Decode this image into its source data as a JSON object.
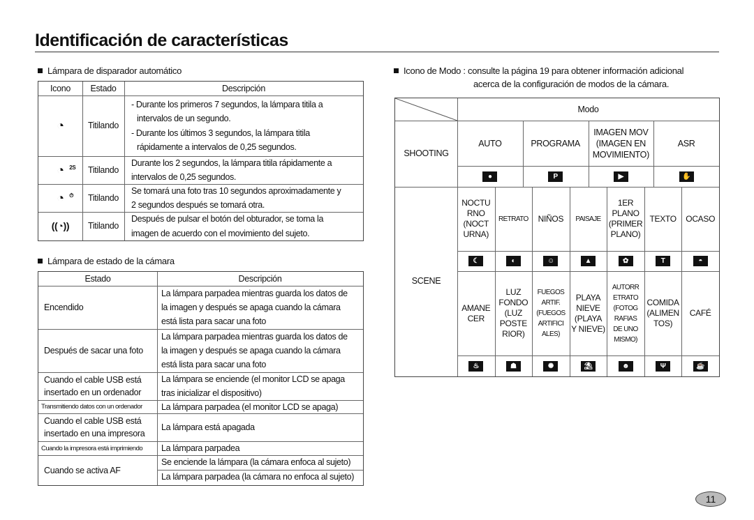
{
  "page": {
    "title": "Identificación de características",
    "page_number": "11"
  },
  "self_timer": {
    "heading": "Lámpara de disparador automático",
    "columns": [
      "Icono",
      "Estado",
      "Descripción"
    ],
    "rows": [
      {
        "icon": "self-timer-10s-icon",
        "estado": "Titilando",
        "lines": [
          "- Durante los primeros 7 segundos, la lámpara titila a",
          "intervalos de un segundo.",
          "- Durante los últimos 3 segundos, la lámpara titila",
          "rápidamente a intervalos de 0,25 segundos."
        ]
      },
      {
        "icon": "self-timer-2s-icon",
        "estado": "Titilando",
        "lines": [
          "Durante los 2 segundos, la lámpara titila rápidamente a",
          "intervalos de 0,25 segundos."
        ]
      },
      {
        "icon": "double-self-timer-icon",
        "estado": "Titilando",
        "lines": [
          "Se tomará una foto tras 10 segundos aproximadamente y",
          "2 segundos después se tomará otra."
        ]
      },
      {
        "icon": "motion-timer-icon",
        "estado": "Titilando",
        "lines": [
          "Después de pulsar el botón del obturador, se toma la",
          "imagen de acuerdo con el movimiento del sujeto."
        ]
      }
    ]
  },
  "camera_status": {
    "heading": "Lámpara de estado de la cámara",
    "columns": [
      "Estado",
      "Descripción"
    ],
    "rows": [
      {
        "estado": [
          "Encendido"
        ],
        "lines": [
          "La lámpara parpadea mientras guarda los datos de",
          "la imagen y  después se apaga cuando la cámara",
          "está lista para sacar una foto"
        ]
      },
      {
        "estado": [
          "Después de sacar una foto"
        ],
        "lines": [
          "La lámpara parpadea mientras guarda los datos de",
          "la imagen y después se apaga cuando la cámara",
          "está lista para sacar una foto"
        ]
      },
      {
        "estado": [
          "Cuando el cable USB está",
          "insertado en un ordenador"
        ],
        "lines": [
          "La lámpara se enciende (el monitor LCD se apaga",
          "tras inicializar el dispositivo)"
        ]
      },
      {
        "estado": [
          "Transmitiendo datos con un ordenador"
        ],
        "lines": [
          "La lámpara parpadea (el monitor LCD se apaga)"
        ]
      },
      {
        "estado": [
          "Cuando el cable USB está",
          "insertado en una impresora"
        ],
        "lines": [
          "La lámpara está apagada"
        ]
      },
      {
        "estado": [
          "Cuando la impresora está imprimiendo"
        ],
        "lines": [
          "La lámpara parpadea"
        ]
      },
      {
        "estado": [
          "Cuando se activa AF"
        ],
        "lines": [
          "Se enciende la lámpara (la cámara enfoca al sujeto)",
          "La lámpara parpadea (la cámara no enfoca al sujeto)"
        ]
      }
    ]
  },
  "mode_icons": {
    "heading_line1": "Icono de Modo : consulte la página 19 para obtener información adicional",
    "heading_line2": "acerca de la configuración de modos de la cámara.",
    "header": "Modo",
    "shooting_label": "SHOOTING",
    "scene_label": "SCENE",
    "shooting": [
      {
        "label": "AUTO",
        "icon": "camera-auto-icon",
        "glyph": "●"
      },
      {
        "label": "PROGRAMA",
        "icon": "camera-program-icon",
        "glyph": "P"
      },
      {
        "label": "IMAGEN MOV\n(IMAGEN EN\nMOVIMIENTO)",
        "icon": "movie-camera-icon",
        "glyph": "▶"
      },
      {
        "label": "ASR",
        "icon": "anti-shake-hand-icon",
        "glyph": "✋"
      }
    ],
    "scene_row1": [
      {
        "label": "NOCTU\nRNO\n(NOCT\nURNA)",
        "icon": "night-moon-icon",
        "glyph": "☾"
      },
      {
        "label": "RETRATO",
        "icon": "portrait-icon",
        "glyph": "◐",
        "narrow": true
      },
      {
        "label": "NIÑOS",
        "icon": "children-icon",
        "glyph": "☺"
      },
      {
        "label": "PAISAJE",
        "icon": "landscape-mountain-icon",
        "glyph": "▲",
        "narrow": true
      },
      {
        "label": "1ER\nPLANO\n(PRIMER\nPLANO)",
        "icon": "macro-flower-icon",
        "glyph": "✿"
      },
      {
        "label": "TEXTO",
        "icon": "text-icon",
        "glyph": "T"
      },
      {
        "label": "OCASO",
        "icon": "sunset-icon",
        "glyph": "◓"
      }
    ],
    "scene_row2": [
      {
        "label": "AMANE\nCER",
        "icon": "dawn-icon",
        "glyph": "♨"
      },
      {
        "label": "LUZ\nFONDO\n(LUZ\nPOSTE\nRIOR)",
        "icon": "backlight-icon",
        "glyph": "☗"
      },
      {
        "label": "FUEGOS\nARTIF.\n(FUEGOS\nARTIFICI\nALES)",
        "icon": "fireworks-icon",
        "glyph": "✺",
        "narrow": true
      },
      {
        "label": "PLAYA\nNIEVE\n(PLAYA\nY NIEVE)",
        "icon": "beach-snow-icon",
        "glyph": "⛱"
      },
      {
        "label": "AUTORR\nETRATO\n(FOTOG\nRAFIAS\nDE UNO\nMISMO)",
        "icon": "self-portrait-icon",
        "glyph": "☻",
        "narrow": true
      },
      {
        "label": "COMIDA\n(ALIMEN\nTOS)",
        "icon": "food-icon",
        "glyph": "Ψ"
      },
      {
        "label": "CAFÉ",
        "icon": "cafe-cup-icon",
        "glyph": "☕"
      }
    ]
  }
}
